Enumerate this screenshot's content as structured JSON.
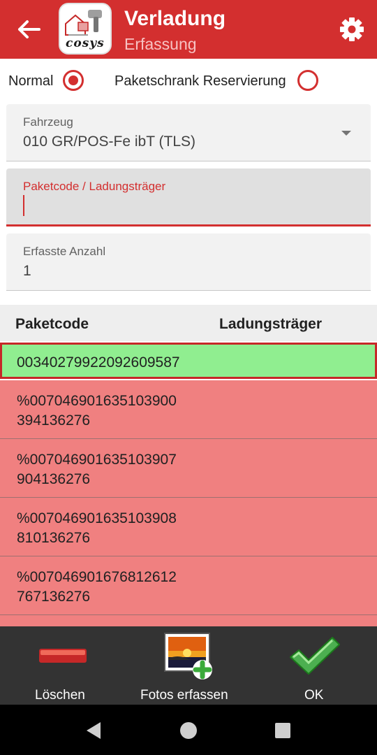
{
  "appbar": {
    "title": "Verladung",
    "subtitle": "Erfassung",
    "back_icon": "arrow-left-icon",
    "settings_icon": "gear-icon",
    "logo_icon": "app-logo-icon",
    "logo_text": "cosys",
    "color": "#d32f2f"
  },
  "mode": {
    "options": [
      {
        "label": "Normal",
        "checked": true
      },
      {
        "label": "Paketschrank Reservierung",
        "checked": false
      }
    ]
  },
  "fields": {
    "vehicle": {
      "label": "Fahrzeug",
      "value": "010 GR/POS-Fe ibT (TLS)"
    },
    "code": {
      "label": "Paketcode / Ladungsträger",
      "value": ""
    },
    "count": {
      "label": "Erfasste Anzahl",
      "value": "1"
    }
  },
  "table": {
    "columns": [
      "Paketcode",
      "Ladungsträger"
    ],
    "rows": [
      {
        "code": "00340279922092609587",
        "carrier": "",
        "status": "ok",
        "status_color": "#90ee90"
      },
      {
        "code": "%007046901635103900\n394136276",
        "carrier": "",
        "status": "error",
        "status_color": "#f08080"
      },
      {
        "code": "%007046901635103907\n904136276",
        "carrier": "",
        "status": "error",
        "status_color": "#f08080"
      },
      {
        "code": "%007046901635103908\n810136276",
        "carrier": "",
        "status": "error",
        "status_color": "#f08080"
      },
      {
        "code": "%007046901676812612\n767136276",
        "carrier": "",
        "status": "error",
        "status_color": "#f08080"
      }
    ]
  },
  "actions": [
    {
      "label": "Löschen",
      "icon": "minus-icon"
    },
    {
      "label": "Fotos erfassen",
      "icon": "add-photo-icon"
    },
    {
      "label": "OK",
      "icon": "checkmark-icon"
    }
  ],
  "nav": {
    "back_icon": "nav-back-icon",
    "home_icon": "nav-home-icon",
    "recents_icon": "nav-recents-icon"
  }
}
